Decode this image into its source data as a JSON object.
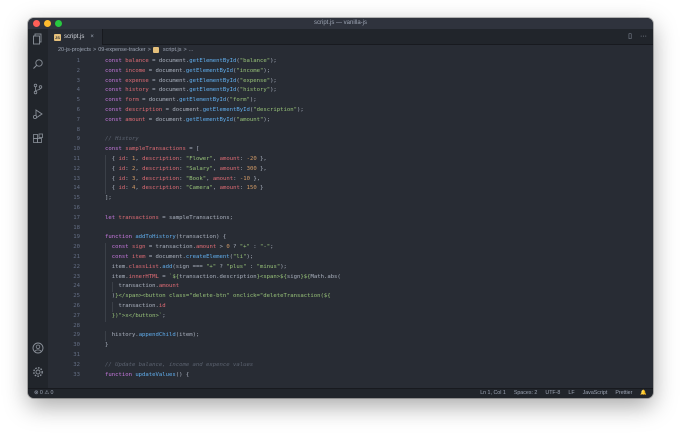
{
  "window": {
    "title": "script.js — vanilla-js"
  },
  "tab": {
    "label": "script.js",
    "close": "×",
    "badge": "JS"
  },
  "tab_actions": {
    "split": "▯",
    "more": "···"
  },
  "breadcrumb": [
    "20-js-projects",
    ">",
    "09-expense-tracker",
    ">",
    "script.js",
    ">",
    "..."
  ],
  "activity_icons": [
    "explorer-icon",
    "search-icon",
    "source-control-icon",
    "run-debug-icon",
    "extensions-icon",
    "account-icon",
    "settings-gear-icon"
  ],
  "code_lines": [
    {
      "n": "1",
      "tokens": [
        [
          "k",
          "const "
        ],
        [
          "v",
          "balance"
        ],
        [
          "p",
          " = document."
        ],
        [
          "f",
          "getElementById"
        ],
        [
          "p",
          "("
        ],
        [
          "s",
          "\"balance\""
        ],
        [
          "p",
          ");"
        ]
      ]
    },
    {
      "n": "2",
      "tokens": [
        [
          "k",
          "const "
        ],
        [
          "v",
          "income"
        ],
        [
          "p",
          " = document."
        ],
        [
          "f",
          "getElementById"
        ],
        [
          "p",
          "("
        ],
        [
          "s",
          "\"income\""
        ],
        [
          "p",
          ");"
        ]
      ]
    },
    {
      "n": "3",
      "tokens": [
        [
          "k",
          "const "
        ],
        [
          "v",
          "expense"
        ],
        [
          "p",
          " = document."
        ],
        [
          "f",
          "getElementById"
        ],
        [
          "p",
          "("
        ],
        [
          "s",
          "\"expense\""
        ],
        [
          "p",
          ");"
        ]
      ]
    },
    {
      "n": "4",
      "tokens": [
        [
          "k",
          "const "
        ],
        [
          "v",
          "history"
        ],
        [
          "p",
          " = document."
        ],
        [
          "f",
          "getElementById"
        ],
        [
          "p",
          "("
        ],
        [
          "s",
          "\"history\""
        ],
        [
          "p",
          ");"
        ]
      ]
    },
    {
      "n": "5",
      "tokens": [
        [
          "k",
          "const "
        ],
        [
          "v",
          "form"
        ],
        [
          "p",
          " = document."
        ],
        [
          "f",
          "getElementById"
        ],
        [
          "p",
          "("
        ],
        [
          "s",
          "\"form\""
        ],
        [
          "p",
          ");"
        ]
      ]
    },
    {
      "n": "6",
      "tokens": [
        [
          "k",
          "const "
        ],
        [
          "v",
          "description"
        ],
        [
          "p",
          " = document."
        ],
        [
          "f",
          "getElementById"
        ],
        [
          "p",
          "("
        ],
        [
          "s",
          "\"description\""
        ],
        [
          "p",
          ");"
        ]
      ]
    },
    {
      "n": "7",
      "tokens": [
        [
          "k",
          "const "
        ],
        [
          "v",
          "amount"
        ],
        [
          "p",
          " = document."
        ],
        [
          "f",
          "getElementById"
        ],
        [
          "p",
          "("
        ],
        [
          "s",
          "\"amount\""
        ],
        [
          "p",
          ");"
        ]
      ]
    },
    {
      "n": "8",
      "tokens": []
    },
    {
      "n": "9",
      "tokens": [
        [
          "c",
          "// History"
        ]
      ]
    },
    {
      "n": "10",
      "tokens": [
        [
          "k",
          "const "
        ],
        [
          "v",
          "sampleTransactions"
        ],
        [
          "p",
          " = ["
        ]
      ]
    },
    {
      "n": "11",
      "tokens": [
        [
          "p",
          "  { "
        ],
        [
          "v",
          "id"
        ],
        [
          "p",
          ": "
        ],
        [
          "n",
          "1"
        ],
        [
          "p",
          ", "
        ],
        [
          "v",
          "description"
        ],
        [
          "p",
          ": "
        ],
        [
          "s",
          "\"Flower\""
        ],
        [
          "p",
          ", "
        ],
        [
          "v",
          "amount"
        ],
        [
          "p",
          ": "
        ],
        [
          "n",
          "-20"
        ],
        [
          "p",
          " },"
        ]
      ]
    },
    {
      "n": "12",
      "tokens": [
        [
          "p",
          "  { "
        ],
        [
          "v",
          "id"
        ],
        [
          "p",
          ": "
        ],
        [
          "n",
          "2"
        ],
        [
          "p",
          ", "
        ],
        [
          "v",
          "description"
        ],
        [
          "p",
          ": "
        ],
        [
          "s",
          "\"Salary\""
        ],
        [
          "p",
          ", "
        ],
        [
          "v",
          "amount"
        ],
        [
          "p",
          ": "
        ],
        [
          "n",
          "300"
        ],
        [
          "p",
          " },"
        ]
      ]
    },
    {
      "n": "13",
      "tokens": [
        [
          "p",
          "  { "
        ],
        [
          "v",
          "id"
        ],
        [
          "p",
          ": "
        ],
        [
          "n",
          "3"
        ],
        [
          "p",
          ", "
        ],
        [
          "v",
          "description"
        ],
        [
          "p",
          ": "
        ],
        [
          "s",
          "\"Book\""
        ],
        [
          "p",
          ", "
        ],
        [
          "v",
          "amount"
        ],
        [
          "p",
          ": "
        ],
        [
          "n",
          "-10"
        ],
        [
          "p",
          " },"
        ]
      ]
    },
    {
      "n": "14",
      "tokens": [
        [
          "p",
          "  { "
        ],
        [
          "v",
          "id"
        ],
        [
          "p",
          ": "
        ],
        [
          "n",
          "4"
        ],
        [
          "p",
          ", "
        ],
        [
          "v",
          "description"
        ],
        [
          "p",
          ": "
        ],
        [
          "s",
          "\"Camera\""
        ],
        [
          "p",
          ", "
        ],
        [
          "v",
          "amount"
        ],
        [
          "p",
          ": "
        ],
        [
          "n",
          "150"
        ],
        [
          "p",
          " }"
        ]
      ]
    },
    {
      "n": "15",
      "tokens": [
        [
          "p",
          "];"
        ]
      ]
    },
    {
      "n": "16",
      "tokens": []
    },
    {
      "n": "17",
      "tokens": [
        [
          "k",
          "let "
        ],
        [
          "v",
          "transactions"
        ],
        [
          "p",
          " = sampleTransactions;"
        ]
      ]
    },
    {
      "n": "18",
      "tokens": []
    },
    {
      "n": "19",
      "tokens": [
        [
          "k",
          "function "
        ],
        [
          "f",
          "addToHistory"
        ],
        [
          "p",
          "(transaction) {"
        ]
      ]
    },
    {
      "n": "20",
      "tokens": [
        [
          "p",
          "  "
        ],
        [
          "k",
          "const "
        ],
        [
          "v",
          "sign"
        ],
        [
          "p",
          " = transaction."
        ],
        [
          "v",
          "amount"
        ],
        [
          "p",
          " > "
        ],
        [
          "n",
          "0"
        ],
        [
          "p",
          " ? "
        ],
        [
          "s",
          "\"+\""
        ],
        [
          "p",
          " : "
        ],
        [
          "s",
          "\"-\""
        ],
        [
          "p",
          ";"
        ]
      ]
    },
    {
      "n": "21",
      "tokens": [
        [
          "p",
          "  "
        ],
        [
          "k",
          "const "
        ],
        [
          "v",
          "item"
        ],
        [
          "p",
          " = document."
        ],
        [
          "f",
          "createElement"
        ],
        [
          "p",
          "("
        ],
        [
          "s",
          "\"li\""
        ],
        [
          "p",
          ");"
        ]
      ]
    },
    {
      "n": "22",
      "tokens": [
        [
          "p",
          "  item."
        ],
        [
          "v",
          "classList"
        ],
        [
          "p",
          "."
        ],
        [
          "f",
          "add"
        ],
        [
          "p",
          "(sign === "
        ],
        [
          "s",
          "\"+\""
        ],
        [
          "p",
          " ? "
        ],
        [
          "s",
          "\"plus\""
        ],
        [
          "p",
          " : "
        ],
        [
          "s",
          "\"minus\""
        ],
        [
          "p",
          ");"
        ]
      ]
    },
    {
      "n": "23",
      "tokens": [
        [
          "p",
          "  item."
        ],
        [
          "v",
          "innerHTML"
        ],
        [
          "p",
          " = "
        ],
        [
          "s",
          "`${"
        ],
        [
          "p",
          "transaction.description"
        ],
        [
          "s",
          "}<span>${"
        ],
        [
          "p",
          "sign"
        ],
        [
          "s",
          "}${"
        ],
        [
          "p",
          "Math.abs("
        ]
      ]
    },
    {
      "n": "24",
      "tokens": [
        [
          "p",
          "    transaction."
        ],
        [
          "v",
          "amount"
        ]
      ]
    },
    {
      "n": "25",
      "tokens": [
        [
          "p",
          "  )"
        ],
        [
          "s",
          "}</span><button class=\"delete-btn\" onclick=\"deleteTransaction(${"
        ]
      ]
    },
    {
      "n": "26",
      "tokens": [
        [
          "p",
          "    transaction."
        ],
        [
          "v",
          "id"
        ]
      ]
    },
    {
      "n": "27",
      "tokens": [
        [
          "p",
          "  "
        ],
        [
          "s",
          "})\">x</button>`"
        ],
        [
          "p",
          ";"
        ]
      ]
    },
    {
      "n": "28",
      "tokens": []
    },
    {
      "n": "29",
      "tokens": [
        [
          "p",
          "  history."
        ],
        [
          "f",
          "appendChild"
        ],
        [
          "p",
          "(item);"
        ]
      ]
    },
    {
      "n": "30",
      "tokens": [
        [
          "p",
          "}"
        ]
      ]
    },
    {
      "n": "31",
      "tokens": []
    },
    {
      "n": "32",
      "tokens": [
        [
          "c",
          "// Update balance, income and expence values"
        ]
      ]
    },
    {
      "n": "33",
      "tokens": [
        [
          "k",
          "function "
        ],
        [
          "f",
          "updateValues"
        ],
        [
          "p",
          "() {"
        ]
      ]
    },
    {
      "n": "34",
      "tokens": [
        [
          "p",
          "  "
        ],
        [
          "k",
          "const "
        ],
        [
          "v",
          "amounts"
        ],
        [
          "p",
          " = transactions."
        ],
        [
          "f",
          "map"
        ],
        [
          "p",
          "(transaction => transaction."
        ],
        [
          "v",
          "amount"
        ],
        [
          "p",
          ");"
        ]
      ]
    }
  ],
  "status": {
    "problems": "⊗ 0 ⚠ 0",
    "position": "Ln 1, Col 1",
    "spaces": "Spaces: 2",
    "encoding": "UTF-8",
    "eol": "LF",
    "language": "JavaScript",
    "formatter": "Prettier",
    "bell": "🔔"
  },
  "colors": {
    "background": "#282c34",
    "keyword": "#c678dd",
    "variable": "#e06c75",
    "function": "#61afef",
    "string": "#98c379",
    "number": "#d19a66",
    "comment": "#5c6370"
  }
}
